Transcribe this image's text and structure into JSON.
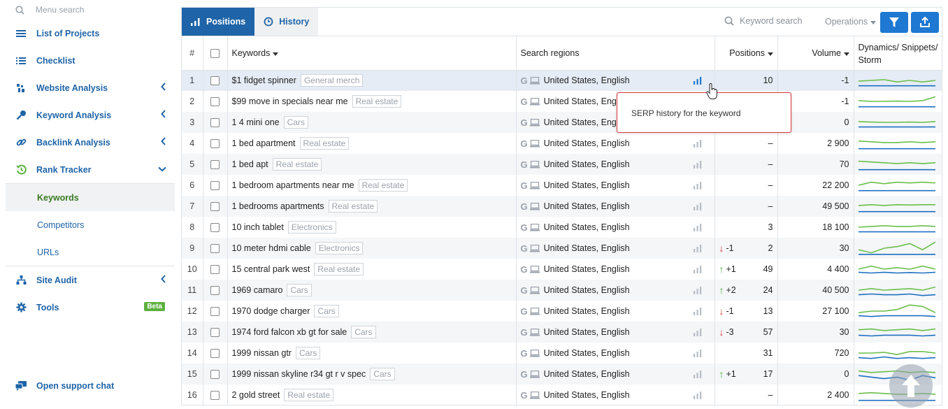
{
  "sidebar": {
    "search_placeholder": "Menu search",
    "items": [
      {
        "label": "List of Projects"
      },
      {
        "label": "Checklist"
      },
      {
        "label": "Website Analysis"
      },
      {
        "label": "Keyword Analysis"
      },
      {
        "label": "Backlink Analysis"
      },
      {
        "label": "Rank Tracker"
      }
    ],
    "rank_tracker_sub": [
      {
        "label": "Keywords"
      },
      {
        "label": "Competitors"
      },
      {
        "label": "URLs"
      }
    ],
    "site_audit": "Site Audit",
    "tools": "Tools",
    "beta": "Beta",
    "support": "Open support chat"
  },
  "toolbar": {
    "tab_positions": "Positions",
    "tab_history": "History",
    "keyword_search": "Keyword search",
    "operations": "Operations"
  },
  "table": {
    "headers": {
      "num": "#",
      "keywords": "Keywords",
      "regions": "Search regions",
      "positions": "Positions",
      "volume": "Volume",
      "dynamics": "Dynamics/ Snippets/ Storm"
    },
    "rows": [
      {
        "n": "1",
        "kw": "$1 fidget spinner",
        "tag": "General merch",
        "region": "United States, English",
        "delta": "",
        "pos": "10",
        "vol": "-1"
      },
      {
        "n": "2",
        "kw": "$99 move in specials near me",
        "tag": "Real estate",
        "region": "United States, English",
        "delta": "",
        "pos": "",
        "vol": "-1"
      },
      {
        "n": "3",
        "kw": "1 4 mini one",
        "tag": "Cars",
        "region": "United States, English",
        "delta": "",
        "pos": "",
        "vol": "0"
      },
      {
        "n": "4",
        "kw": "1 bed apartment",
        "tag": "Real estate",
        "region": "United States, English",
        "delta": "",
        "pos": "–",
        "vol": "2 900"
      },
      {
        "n": "5",
        "kw": "1 bed apt",
        "tag": "Real estate",
        "region": "United States, English",
        "delta": "",
        "pos": "–",
        "vol": "70"
      },
      {
        "n": "6",
        "kw": "1 bedroom apartments near me",
        "tag": "Real estate",
        "region": "United States, English",
        "delta": "",
        "pos": "–",
        "vol": "22 200"
      },
      {
        "n": "7",
        "kw": "1 bedrooms apartments",
        "tag": "Real estate",
        "region": "United States, English",
        "delta": "",
        "pos": "–",
        "vol": "49 500"
      },
      {
        "n": "8",
        "kw": "10 inch tablet",
        "tag": "Electronics",
        "region": "United States, English",
        "delta": "",
        "pos": "3",
        "vol": "18 100"
      },
      {
        "n": "9",
        "kw": "10 meter hdmi cable",
        "tag": "Electronics",
        "region": "United States, English",
        "delta": "-1",
        "dir": "down",
        "pos": "2",
        "vol": "30"
      },
      {
        "n": "10",
        "kw": "15 central park west",
        "tag": "Real estate",
        "region": "United States, English",
        "delta": "+1",
        "dir": "up",
        "pos": "49",
        "vol": "4 400"
      },
      {
        "n": "11",
        "kw": "1969 camaro",
        "tag": "Cars",
        "region": "United States, English",
        "delta": "+2",
        "dir": "up",
        "pos": "24",
        "vol": "40 500"
      },
      {
        "n": "12",
        "kw": "1970 dodge charger",
        "tag": "Cars",
        "region": "United States, English",
        "delta": "-1",
        "dir": "down",
        "pos": "13",
        "vol": "27 100"
      },
      {
        "n": "13",
        "kw": "1974 ford falcon xb gt for sale",
        "tag": "Cars",
        "region": "United States, English",
        "delta": "-3",
        "dir": "down",
        "pos": "57",
        "vol": "30"
      },
      {
        "n": "14",
        "kw": "1999 nissan gtr",
        "tag": "Cars",
        "region": "United States, English",
        "delta": "",
        "pos": "31",
        "vol": "720"
      },
      {
        "n": "15",
        "kw": "1999 nissan skyline r34 gt r v spec",
        "tag": "Cars",
        "region": "United States, English",
        "delta": "+1",
        "dir": "up",
        "pos": "17",
        "vol": "0"
      },
      {
        "n": "16",
        "kw": "2 gold street",
        "tag": "Real estate",
        "region": "United States, English",
        "delta": "",
        "pos": "–",
        "vol": "2 400"
      }
    ]
  },
  "tooltip": "SERP history for the keyword",
  "colors": {
    "brand_blue": "#1f64a8",
    "button_blue": "#1f78d1",
    "green": "#5db03f",
    "red": "#d93636"
  }
}
